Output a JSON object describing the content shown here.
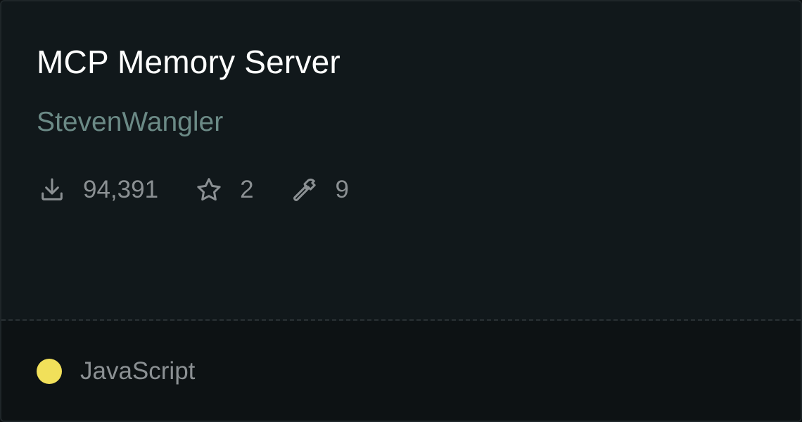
{
  "card": {
    "title": "MCP Memory Server",
    "author": "StevenWangler",
    "stats": {
      "downloads": "94,391",
      "stars": "2",
      "tools": "9"
    },
    "language": {
      "name": "JavaScript",
      "color": "#f1e05a"
    },
    "icons": {
      "downloads": "download-icon",
      "stars": "star-icon",
      "tools": "hammer-icon"
    }
  }
}
